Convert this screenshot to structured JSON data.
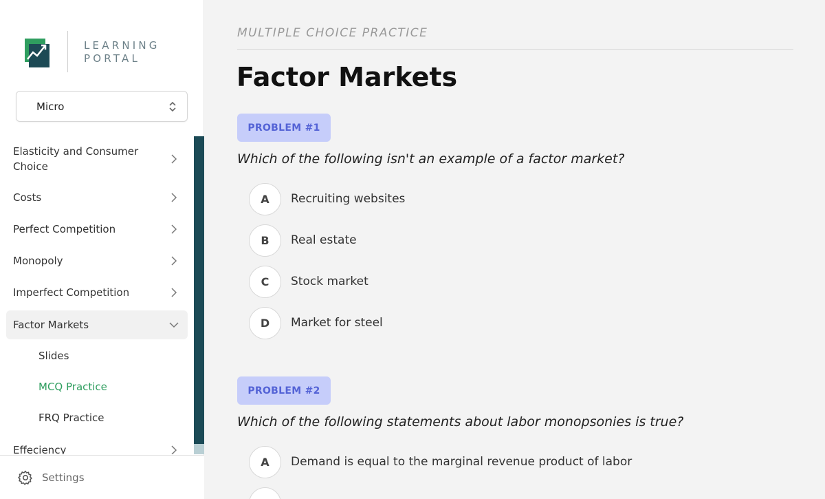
{
  "sidebar": {
    "logo_line1": "LEARNING",
    "logo_line2": "PORTAL",
    "course_select": "Micro",
    "items": [
      {
        "label": "Elasticity and Consumer Choice"
      },
      {
        "label": "Costs"
      },
      {
        "label": "Perfect Competition"
      },
      {
        "label": "Monopoly"
      },
      {
        "label": "Imperfect Competition"
      },
      {
        "label": "Factor Markets"
      },
      {
        "label": "Effeciency"
      }
    ],
    "sub_items": [
      {
        "label": "Slides"
      },
      {
        "label": "MCQ Practice"
      },
      {
        "label": "FRQ Practice"
      }
    ],
    "settings_label": "Settings"
  },
  "main": {
    "kicker": "MULTIPLE CHOICE PRACTICE",
    "title": "Factor Markets",
    "problems": [
      {
        "badge": "PROBLEM #1",
        "question": "Which of the following isn't an example of a factor market?",
        "options": [
          {
            "letter": "A",
            "text": "Recruiting websites"
          },
          {
            "letter": "B",
            "text": "Real estate"
          },
          {
            "letter": "C",
            "text": "Stock market"
          },
          {
            "letter": "D",
            "text": "Market for steel"
          }
        ]
      },
      {
        "badge": "PROBLEM #2",
        "question": "Which of the following statements about labor monopsonies is true?",
        "options": [
          {
            "letter": "A",
            "text": "Demand is equal to the marginal revenue product of labor"
          },
          {
            "letter": "B",
            "text": ""
          }
        ]
      }
    ]
  },
  "colors": {
    "accent_green": "#2f9e5f",
    "brand_dark": "#1d4a55",
    "badge_bg": "#c6cdfa",
    "badge_text": "#5463d6"
  }
}
